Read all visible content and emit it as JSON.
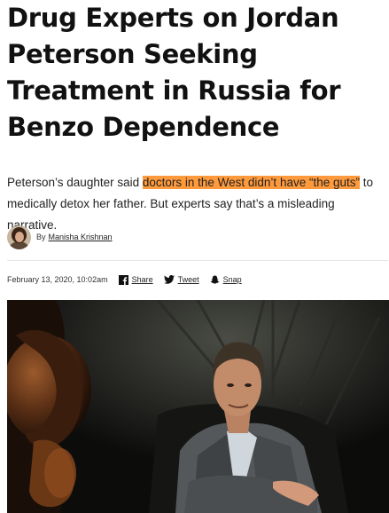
{
  "article": {
    "headline": "Drug Experts on Jordan Peterson Seeking Treatment in Russia for Benzo Dependence",
    "dek_before": "Peterson’s daughter said ",
    "dek_highlight": "doctors in the West didn’t have “the guts”",
    "dek_after": " to medically detox her father. But experts say that’s a misleading narrative.",
    "byline_prefix": "By",
    "author": "Manisha Krishnan",
    "date": "February 13, 2020, 10:02am"
  },
  "share": {
    "facebook_label": "Share",
    "twitter_label": "Tweet",
    "snapchat_label": "Snap"
  },
  "colors": {
    "highlight": "#ff9a3c",
    "text": "#111111"
  },
  "icons": [
    "facebook-icon",
    "twitter-icon",
    "snapchat-icon"
  ]
}
